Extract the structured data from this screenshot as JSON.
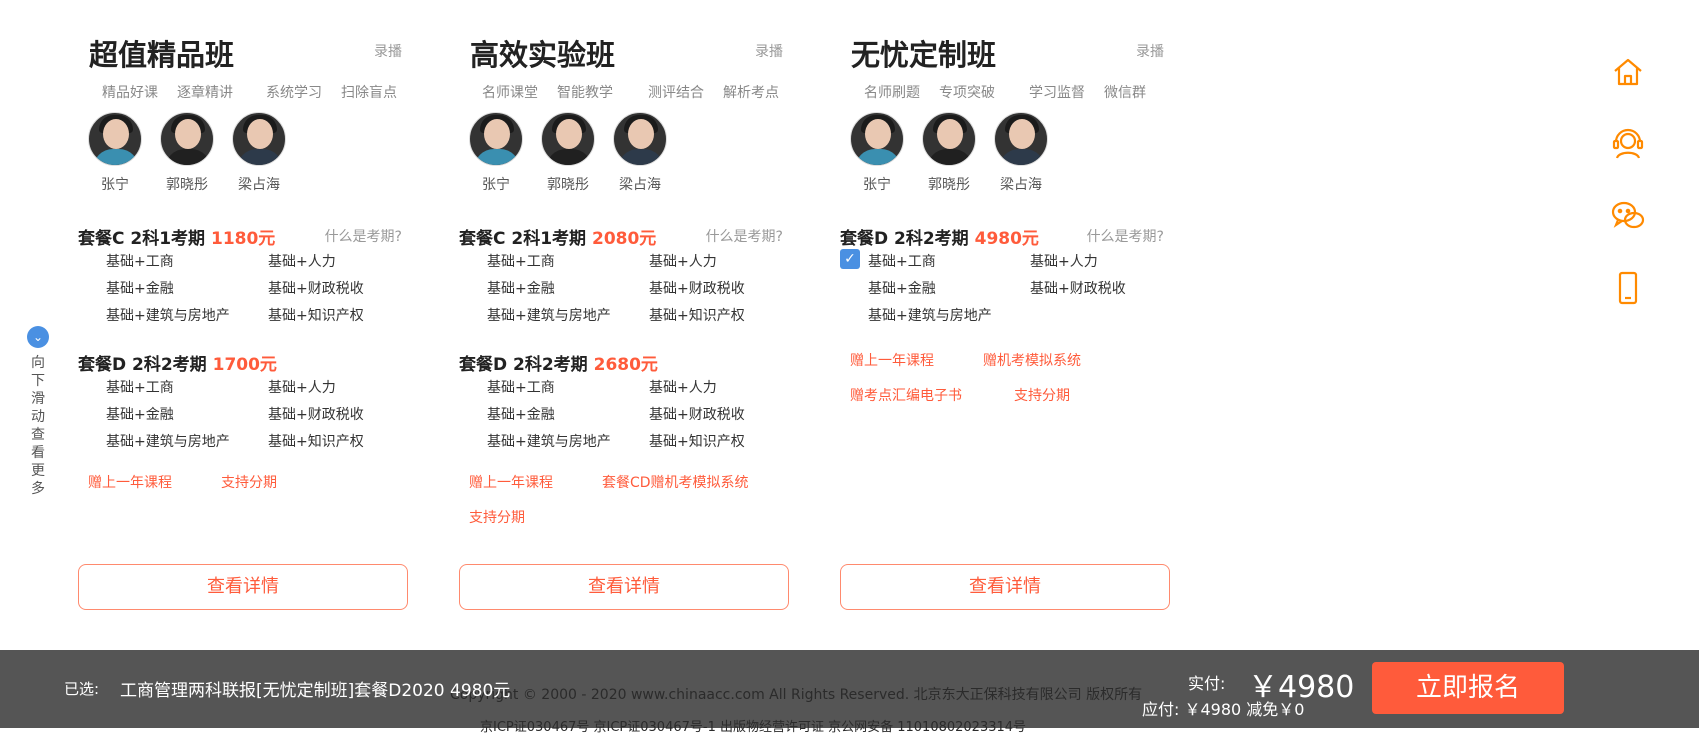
{
  "cards": [
    {
      "title": "超值精品班",
      "tag": "录播",
      "features": [
        "精品好课",
        "逐章精讲",
        "系统学习",
        "扫除盲点"
      ],
      "teachers": [
        "张宁",
        "郭晓彤",
        "梁占海"
      ],
      "packages": [
        {
          "title": "套餐C 2科1考期 ",
          "price": "1180元",
          "question": "什么是考期?",
          "subjects": [
            "基础+工商",
            "基础+人力",
            "基础+金融",
            "基础+财政税收",
            "基础+建筑与房地产",
            "基础+知识产权"
          ]
        },
        {
          "title": "套餐D 2科2考期 ",
          "price": "1700元",
          "question": "",
          "subjects": [
            "基础+工商",
            "基础+人力",
            "基础+金融",
            "基础+财政税收",
            "基础+建筑与房地产",
            "基础+知识产权"
          ]
        }
      ],
      "gifts": [
        "赠上一年课程",
        "支持分期"
      ],
      "detail_label": "查看详情"
    },
    {
      "title": "高效实验班",
      "tag": "录播",
      "features": [
        "名师课堂",
        "智能教学",
        "测评结合",
        "解析考点"
      ],
      "teachers": [
        "张宁",
        "郭晓彤",
        "梁占海"
      ],
      "packages": [
        {
          "title": "套餐C 2科1考期 ",
          "price": "2080元",
          "question": "什么是考期?",
          "subjects": [
            "基础+工商",
            "基础+人力",
            "基础+金融",
            "基础+财政税收",
            "基础+建筑与房地产",
            "基础+知识产权"
          ]
        },
        {
          "title": "套餐D 2科2考期 ",
          "price": "2680元",
          "question": "",
          "subjects": [
            "基础+工商",
            "基础+人力",
            "基础+金融",
            "基础+财政税收",
            "基础+建筑与房地产",
            "基础+知识产权"
          ]
        }
      ],
      "gifts": [
        "赠上一年课程",
        "套餐CD赠机考模拟系统",
        "支持分期"
      ],
      "detail_label": "查看详情"
    },
    {
      "title": "无忧定制班",
      "tag": "录播",
      "features": [
        "名师刷题",
        "专项突破",
        "学习监督",
        "微信群"
      ],
      "teachers": [
        "张宁",
        "郭晓彤",
        "梁占海"
      ],
      "packages": [
        {
          "title": "套餐D 2科2考期 ",
          "price": "4980元",
          "question": "什么是考期?",
          "subjects": [
            "基础+工商",
            "基础+人力",
            "基础+金融",
            "基础+财政税收",
            "基础+建筑与房地产"
          ]
        }
      ],
      "gifts": [
        "赠上一年课程",
        "赠机考模拟系统",
        "赠考点汇编电子书",
        "支持分期"
      ],
      "detail_label": "查看详情"
    }
  ],
  "scroll_hint": "向下滑动查看更多",
  "side_icons": [
    "home-icon",
    "headset-icon",
    "wechat-icon",
    "mobile-icon"
  ],
  "colors": {
    "accent": "#ff5b3b",
    "side_icon": "#ff8a00",
    "checkbox": "#4a90e2",
    "bar": "#555555"
  },
  "footer": {
    "copyright": "Copyright © 2000 - 2020 www.chinaacc.com All Rights Reserved.   北京东大正保科技有限公司 版权所有",
    "license": "京ICP证030467号   京ICP证030467号-1   出版物经营许可证   京公网安备 11010802023314号"
  },
  "bottom_bar": {
    "selected_label": "已选:",
    "selected_value": "工商管理两科联报[无忧定制班]套餐D2020   4980元",
    "paid_label": "实付:",
    "paid_amount": "￥4980",
    "due_text": "应付: ￥4980    减免￥0",
    "enroll_label": "立即报名"
  }
}
